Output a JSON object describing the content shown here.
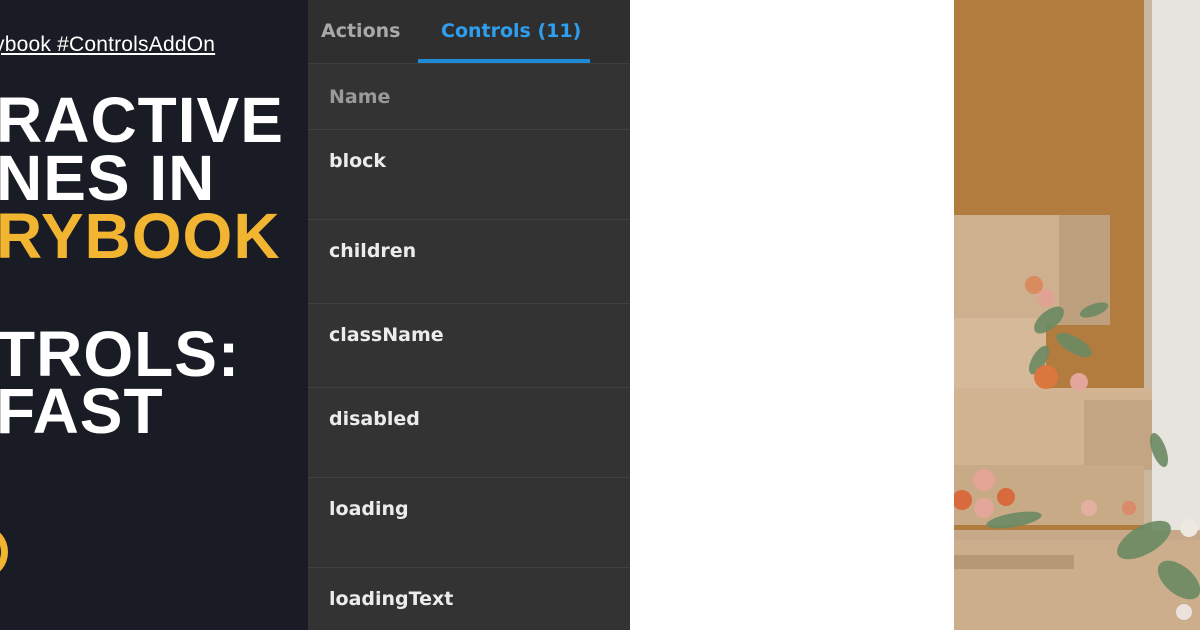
{
  "hero": {
    "tagline": "ybook #ControlsAddOn",
    "lines": [
      {
        "text": "RACTIVE",
        "accent": false
      },
      {
        "text": "NES IN",
        "accent": false
      },
      {
        "text": "RYBOOK",
        "accent": true
      },
      {
        "text": "TROLS:",
        "accent": false
      },
      {
        "text": "FAST",
        "accent": false
      }
    ]
  },
  "storybook": {
    "tabs": {
      "actions": "Actions",
      "controls": "Controls (11)"
    },
    "column_header": "Name",
    "rows": [
      "block",
      "children",
      "className",
      "disabled",
      "loading",
      "loadingText"
    ]
  },
  "colors": {
    "accent": "#f2b531",
    "active_tab": "#2e9ff0",
    "panel_bg": "#333333",
    "hero_bg": "#191c24"
  }
}
